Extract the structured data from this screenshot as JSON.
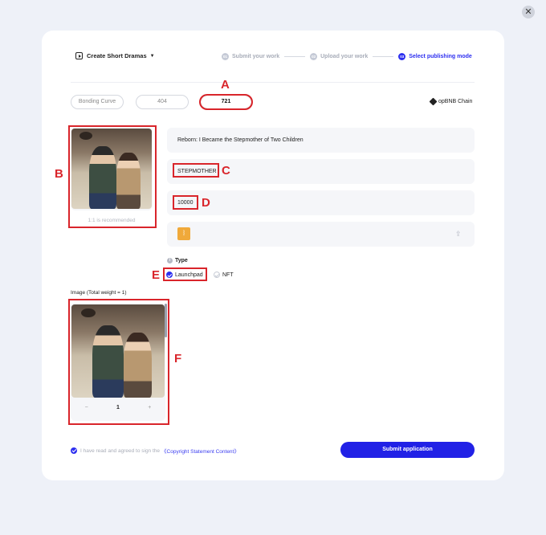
{
  "header": {
    "create_menu_label": "Create Short Dramas",
    "steps": [
      {
        "num": "01",
        "label": "Submit your work"
      },
      {
        "num": "02",
        "label": "Upload your work"
      },
      {
        "num": "03",
        "label": "Select publishing mode"
      }
    ]
  },
  "mode_tabs": [
    "Bonding Curve",
    "404",
    "721"
  ],
  "active_tab": "721",
  "chain_label": "opBNB Chain",
  "cover": {
    "hint": "1:1 is recommended"
  },
  "fields": {
    "title": "Reborn: I Became the Stepmother of Two Children",
    "symbol": "STEPMOTHER",
    "supply": "10000"
  },
  "type": {
    "label": "Type",
    "options": [
      "Launchpad",
      "NFT"
    ],
    "selected": "Launchpad"
  },
  "images": {
    "title": "Image (Total weight = 1)",
    "weight": "1",
    "minus": "−",
    "plus": "+"
  },
  "footer": {
    "agree_text": "I have read and agreed to sign the",
    "agree_link": "《Copyright Statement Content》",
    "submit_label": "Submit application"
  },
  "annotations": [
    "A",
    "B",
    "C",
    "D",
    "E",
    "F"
  ],
  "colors": {
    "accent": "#2d2ff0",
    "annotation": "#d9252b"
  }
}
